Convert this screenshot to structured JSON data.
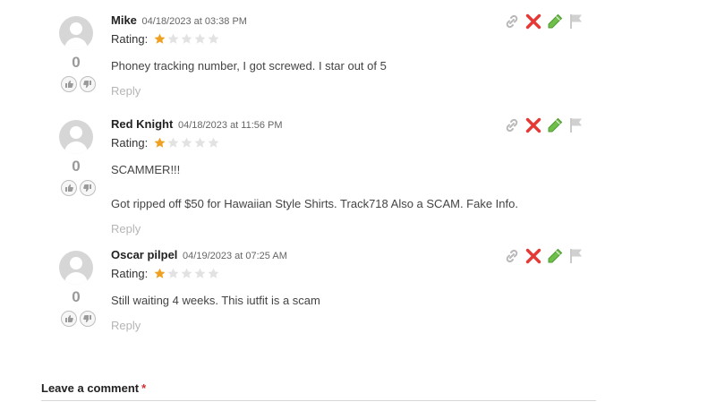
{
  "comments": [
    {
      "author": "Mike",
      "date": "04/18/2023 at 03:38 PM",
      "rating_label": "Rating:",
      "rating": 1,
      "rating_max": 5,
      "votes": "0",
      "paragraphs": [
        "Phoney tracking number, I got screwed. I star out of 5"
      ],
      "reply_label": "Reply"
    },
    {
      "author": "Red Knight",
      "date": "04/18/2023 at 11:56 PM",
      "rating_label": "Rating:",
      "rating": 1,
      "rating_max": 5,
      "votes": "0",
      "paragraphs": [
        "SCAMMER!!!",
        "Got ripped off $50 for Hawaiian Style Shirts. Track718 Also a SCAM. Fake Info."
      ],
      "reply_label": "Reply"
    },
    {
      "author": "Oscar pilpel",
      "date": "04/19/2023 at 07:25 AM",
      "rating_label": "Rating:",
      "rating": 1,
      "rating_max": 5,
      "votes": "0",
      "paragraphs": [
        "Still waiting 4 weeks. This iutfit is a scam"
      ],
      "reply_label": "Reply"
    }
  ],
  "actions": [
    "link-icon",
    "delete-icon",
    "edit-icon",
    "flag-icon"
  ],
  "colors": {
    "star_filled": "#f0a020",
    "star_empty": "#e2e2e2",
    "delete": "#e53935",
    "edit": "#6fbf4a",
    "link": "#b8b8b8",
    "flag": "#d0d0d0"
  },
  "leave_comment": {
    "title": "Leave a comment",
    "required_mark": "*"
  }
}
